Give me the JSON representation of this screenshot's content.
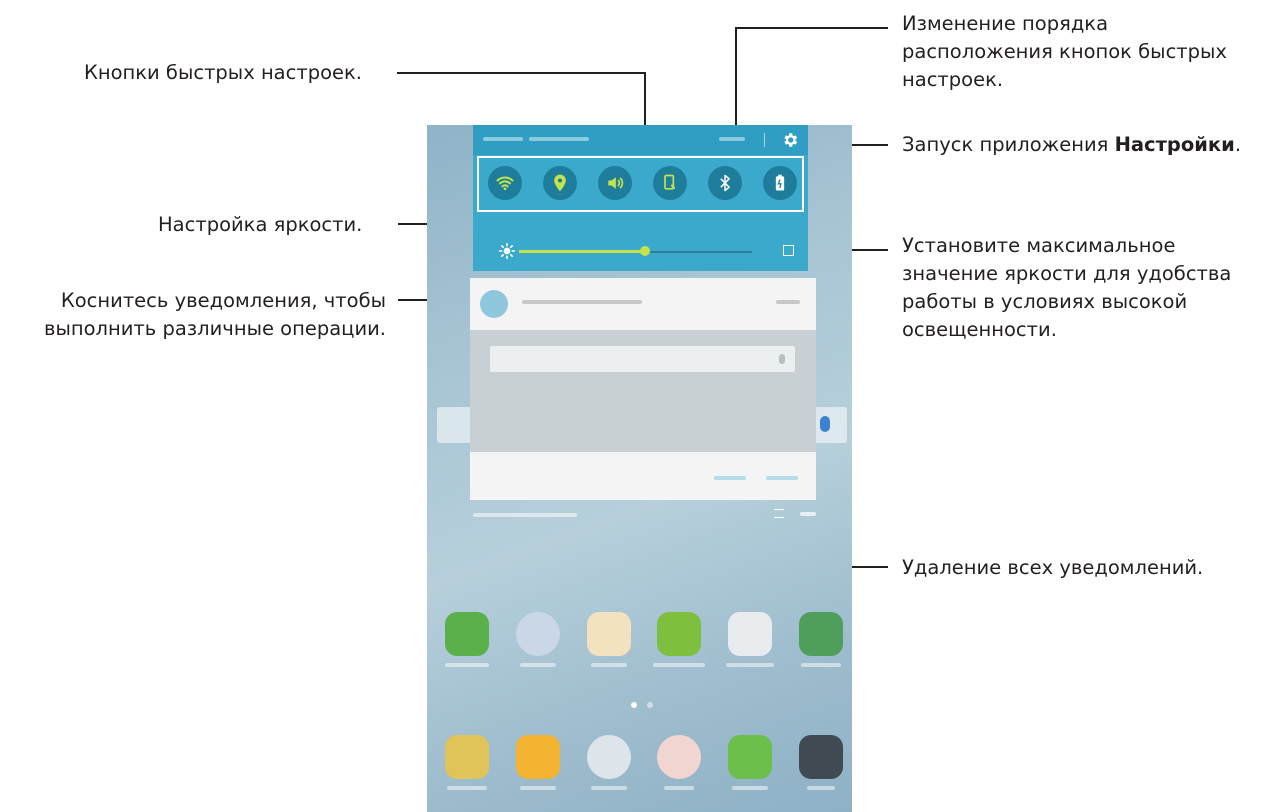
{
  "callouts": {
    "quick_buttons": "Кнопки быстрых настроек.",
    "reorder_line1": "Изменение порядка",
    "reorder_line2": "расположения кнопок быстрых",
    "reorder_line3": "настроек.",
    "launch_prefix": "Запуск приложения ",
    "launch_bold": "Настройки",
    "launch_suffix": ".",
    "brightness": "Настройка яркости.",
    "max_line1": "Установите максимальное",
    "max_line2": "значение яркости для удобства",
    "max_line3": "работы в условиях высокой",
    "max_line4": "освещенности.",
    "touch_line1": "Коснитесь уведомления, чтобы",
    "touch_line2": "выполнить различные операции.",
    "clear_all": "Удаление всех уведомлений."
  },
  "quick_settings": [
    {
      "name": "wifi-icon",
      "active": true
    },
    {
      "name": "location-icon",
      "active": true
    },
    {
      "name": "sound-icon",
      "active": true
    },
    {
      "name": "screen-rotation-icon",
      "active": true
    },
    {
      "name": "bluetooth-icon",
      "active": false
    },
    {
      "name": "power-saving-icon",
      "active": false
    }
  ],
  "brightness": {
    "level": 0.54
  },
  "colors": {
    "panel": "#3aa9cc",
    "qs_button": "#1f7d9c",
    "qs_active": "#c5e34b",
    "slider_active": "#c5e34b"
  }
}
